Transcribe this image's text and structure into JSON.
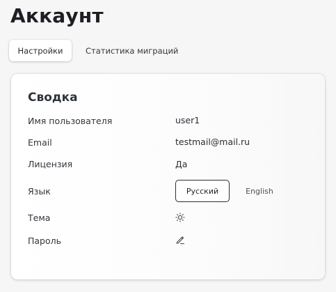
{
  "page": {
    "title": "Аккаунт"
  },
  "tabs": [
    {
      "label": "Настройки",
      "active": true
    },
    {
      "label": "Статистика миграций",
      "active": false
    }
  ],
  "summary": {
    "title": "Сводка",
    "username": {
      "label": "Имя пользователя",
      "value": "user1"
    },
    "email": {
      "label": "Email",
      "value": "testmail@mail.ru"
    },
    "license": {
      "label": "Лицензия",
      "value": "Да"
    },
    "language": {
      "label": "Язык",
      "options": [
        {
          "label": "Русский",
          "selected": true
        },
        {
          "label": "English",
          "selected": false
        }
      ]
    },
    "theme": {
      "label": "Тема",
      "icon": "sun-icon"
    },
    "password": {
      "label": "Пароль",
      "icon": "pencil-icon"
    }
  },
  "colors": {
    "background": "#f6f6f7",
    "card": "#ffffff",
    "text": "#23262b",
    "selected_border": "#2b2e34"
  }
}
